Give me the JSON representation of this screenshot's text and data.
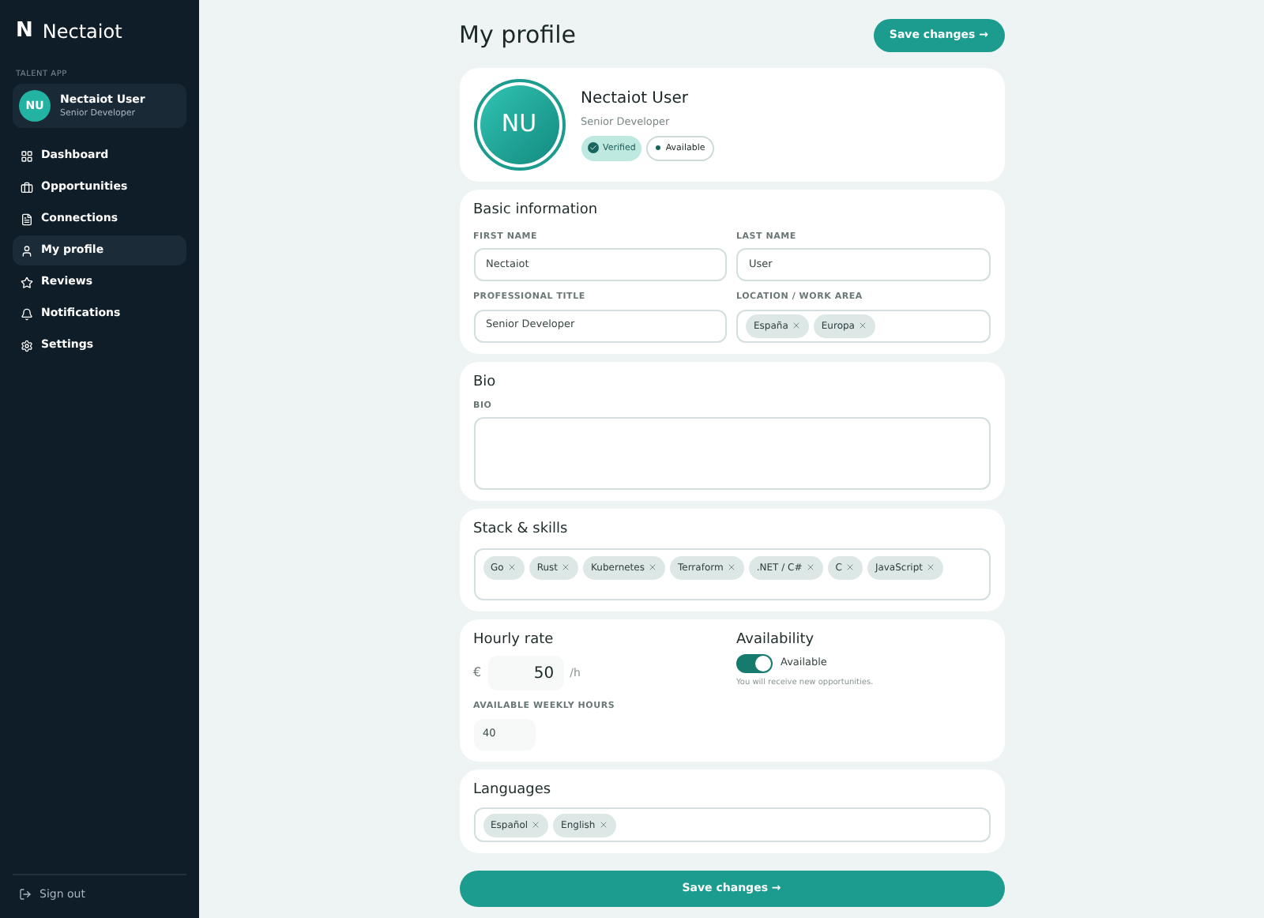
{
  "sidebar": {
    "logo_mark": "N",
    "logo_text": "Nectaiot",
    "section_label": "TALENT APP",
    "user": {
      "initials": "NU",
      "name": "Nectaiot User",
      "title": "Senior Developer"
    },
    "items": [
      {
        "label": "Dashboard",
        "selected": false
      },
      {
        "label": "Opportunities",
        "selected": false
      },
      {
        "label": "Connections",
        "selected": false
      },
      {
        "label": "My profile",
        "selected": true
      },
      {
        "label": "Reviews",
        "selected": false
      },
      {
        "label": "Notifications",
        "selected": false
      },
      {
        "label": "Settings",
        "selected": false
      }
    ],
    "sign_out": "Sign out"
  },
  "header": {
    "title": "My profile",
    "save_button": "Save changes →"
  },
  "profile": {
    "initials": "NU",
    "name": "Nectaiot User",
    "title": "Senior Developer",
    "badges": [
      {
        "label": "Verified",
        "kind": "verified"
      },
      {
        "label": "Available",
        "kind": "status"
      }
    ]
  },
  "basic": {
    "title": "Basic information",
    "fields": [
      {
        "label": "FIRST NAME",
        "value": "Nectaiot",
        "kind": "text"
      },
      {
        "label": "LAST NAME",
        "value": "User",
        "kind": "text"
      },
      {
        "label": "PROFESSIONAL TITLE",
        "value": "Senior Developer",
        "kind": "text"
      },
      {
        "label": "LOCATION / WORK AREA",
        "kind": "chips",
        "chips": [
          "España",
          "Europa"
        ]
      }
    ]
  },
  "bio": {
    "title": "Bio",
    "label": "BIO"
  },
  "skills": {
    "title": "Stack & skills",
    "chips": [
      "Go",
      "Rust",
      "Kubernetes",
      "Terraform",
      ".NET / C#",
      "C",
      "JavaScript"
    ]
  },
  "rate": {
    "title": "Hourly rate",
    "currency": "€",
    "value": "50",
    "unit": "/h",
    "hours_label": "AVAILABLE WEEKLY HOURS",
    "hours": "40"
  },
  "availability": {
    "title": "Availability",
    "on": true,
    "label": "Available",
    "note": "You will receive new opportunities."
  },
  "languages": {
    "title": "Languages",
    "chips": [
      "Español",
      "English"
    ]
  },
  "footer_button": "Save changes →"
}
